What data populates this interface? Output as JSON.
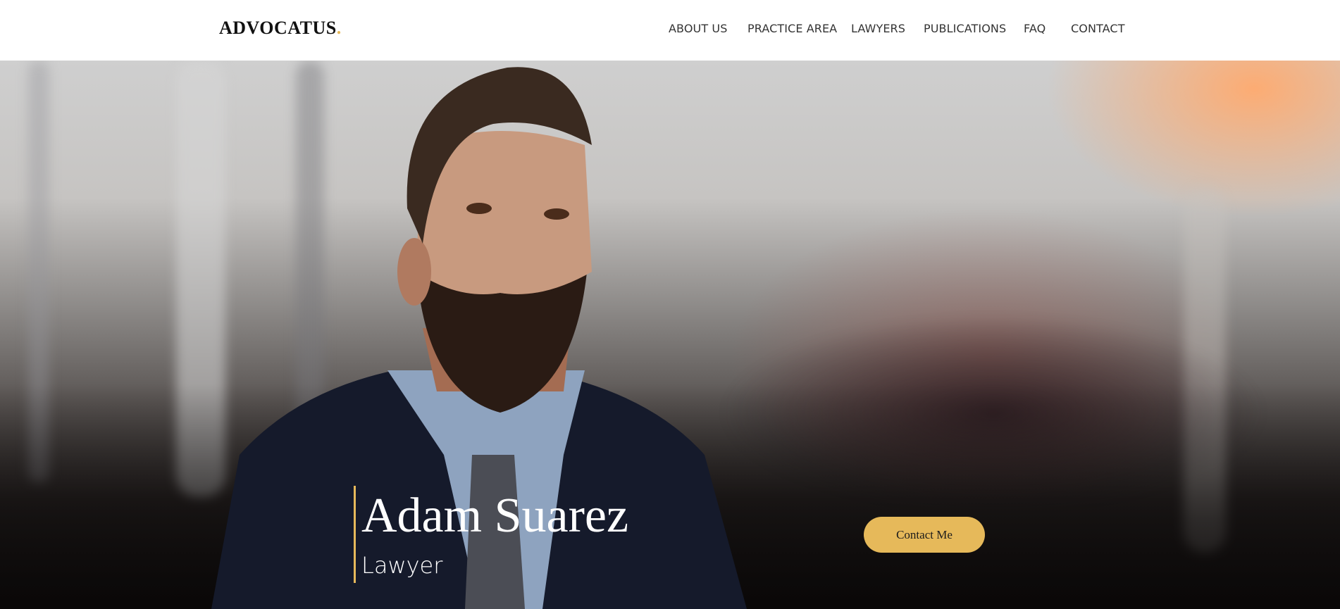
{
  "brand": {
    "name": "ADVOCATUS",
    "dot": ".",
    "accent_color": "#e6b95a"
  },
  "nav": {
    "items": [
      {
        "label": "ABOUT US"
      },
      {
        "label": "PRACTICE AREA"
      },
      {
        "label": "LAWYERS"
      },
      {
        "label": "PUBLICATIONS"
      },
      {
        "label": "FAQ"
      },
      {
        "label": "CONTACT"
      }
    ]
  },
  "hero": {
    "name": "Adam Suarez",
    "role": "Lawyer",
    "cta_label": "Contact Me",
    "image_subject": "bearded man in suit and tie, blurred station background"
  }
}
